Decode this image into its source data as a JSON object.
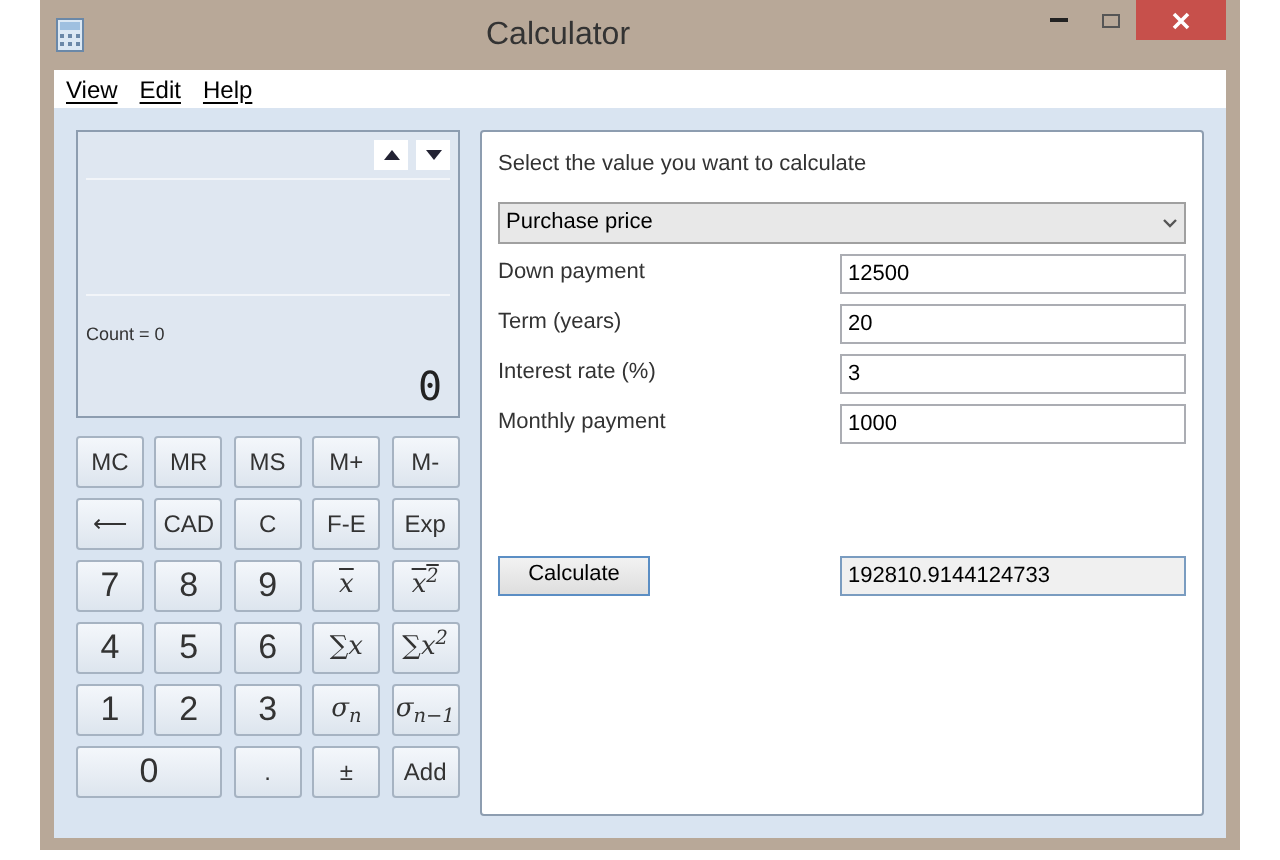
{
  "window": {
    "title": "Calculator"
  },
  "menu": [
    "View",
    "Edit",
    "Help"
  ],
  "display": {
    "count": "Count = 0",
    "value": "0"
  },
  "keys": [
    {
      "label": "MC",
      "kind": "small"
    },
    {
      "label": "MR",
      "kind": "small"
    },
    {
      "label": "MS",
      "kind": "small"
    },
    {
      "label": "M+",
      "kind": "small"
    },
    {
      "label": "M-",
      "kind": "small"
    },
    {
      "label": "⟵",
      "kind": "small"
    },
    {
      "label": "CAD",
      "kind": "small"
    },
    {
      "label": "C",
      "kind": "small"
    },
    {
      "label": "F-E",
      "kind": "small"
    },
    {
      "label": "Exp",
      "kind": "small"
    },
    {
      "label": "7",
      "kind": "digit"
    },
    {
      "label": "8",
      "kind": "digit"
    },
    {
      "label": "9",
      "kind": "digit"
    },
    {
      "label": "x",
      "kind": "math",
      "overline": true
    },
    {
      "label": "x$^{2}$",
      "kind": "math",
      "overline": true
    },
    {
      "label": "4",
      "kind": "digit"
    },
    {
      "label": "5",
      "kind": "digit"
    },
    {
      "label": "6",
      "kind": "digit"
    },
    {
      "label": "∑x",
      "kind": "math",
      "overline": false
    },
    {
      "label": "∑x$^{2}$",
      "kind": "math",
      "overline": false
    },
    {
      "label": "1",
      "kind": "digit"
    },
    {
      "label": "2",
      "kind": "digit"
    },
    {
      "label": "3",
      "kind": "digit"
    },
    {
      "label": "σ$_{n}$",
      "kind": "math",
      "overline": false
    },
    {
      "label": "σ$_{n−1}$",
      "kind": "math",
      "overline": false
    },
    {
      "label": "0",
      "kind": "wide"
    },
    {
      "label": ".",
      "kind": "small"
    },
    {
      "label": "±",
      "kind": "small"
    },
    {
      "label": "Add",
      "kind": "small"
    }
  ],
  "form": {
    "prompt": "Select the value you want to calculate",
    "select": "Purchase price",
    "fields": [
      {
        "label": "Down payment",
        "value": "12500"
      },
      {
        "label": "Term (years)",
        "value": "20"
      },
      {
        "label": "Interest rate (%)",
        "value": "3"
      },
      {
        "label": "Monthly payment",
        "value": "1000"
      }
    ],
    "button": "Calculate",
    "result": "192810.9144124733"
  }
}
